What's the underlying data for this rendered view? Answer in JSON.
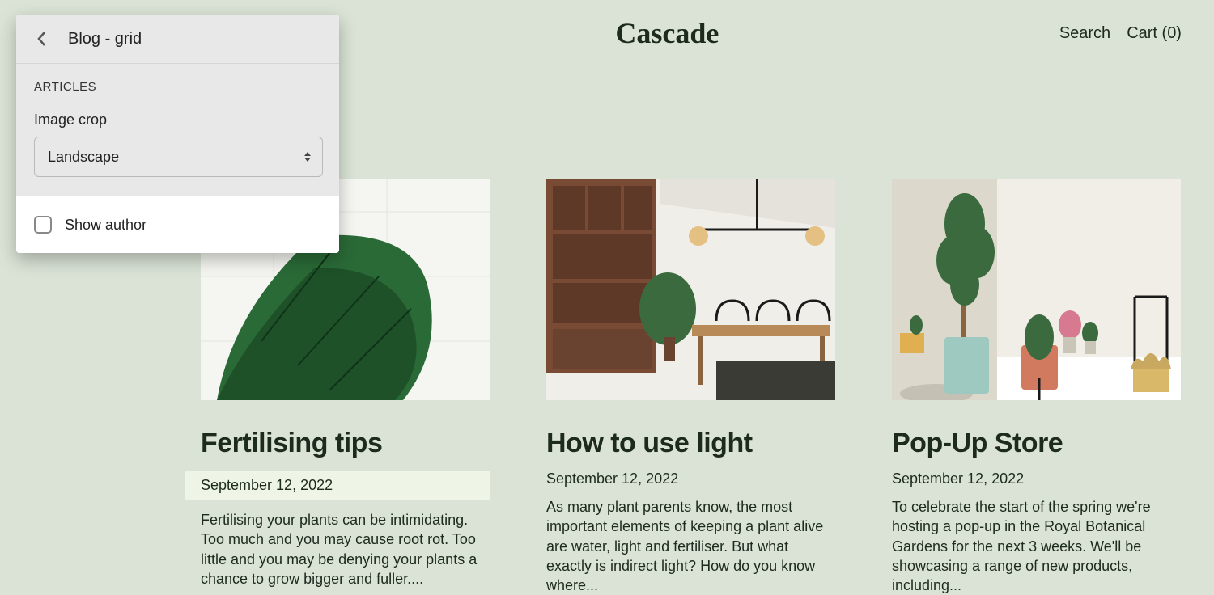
{
  "header": {
    "brand": "Cascade",
    "search": "Search",
    "cart": "Cart (0)"
  },
  "panel": {
    "title": "Blog - grid",
    "section_heading": "ARTICLES",
    "image_crop_label": "Image crop",
    "image_crop_value": "Landscape",
    "show_author_label": "Show author"
  },
  "articles": [
    {
      "title": "Fertilising tips",
      "date": "September 12, 2022",
      "excerpt": "Fertilising your plants can be intimidating. Too much and you may cause root rot. Too little and you may be denying your plants a chance to grow bigger and fuller...."
    },
    {
      "title": "How to use light",
      "date": "September 12, 2022",
      "excerpt": "As many plant parents know, the most important elements of keeping a plant alive are water, light and fertiliser. But what exactly is indirect light? How do you know where..."
    },
    {
      "title": "Pop-Up Store",
      "date": "September 12, 2022",
      "excerpt": "To celebrate the start of the spring we're hosting a pop-up in the Royal Botanical Gardens for the next 3 weeks.   We'll be showcasing a range of new products, including..."
    }
  ]
}
